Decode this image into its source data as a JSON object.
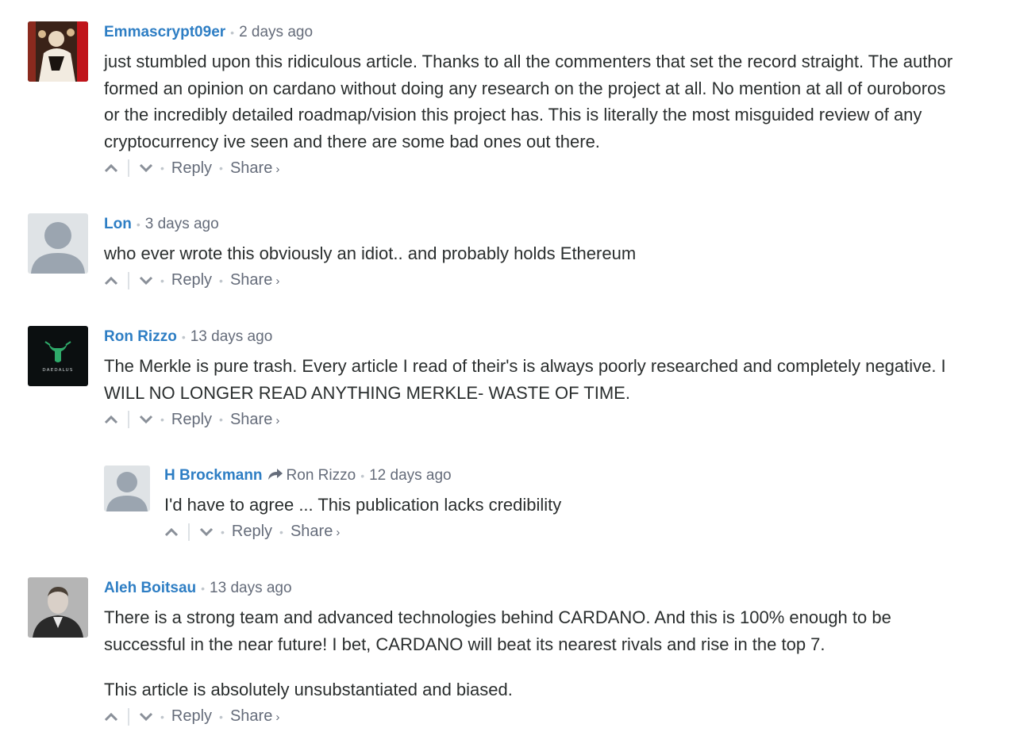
{
  "comments": [
    {
      "author": "Emmascrypt09er",
      "time": "2 days ago",
      "paragraphs": [
        "just stumbled upon this ridiculous article. Thanks to all the commenters that set the record straight. The author formed an opinion on cardano without doing any research on the project at all. No mention at all of ouroboros or the incredibly detailed roadmap/vision this project has. This is literally the most misguided review of any cryptocurrency ive seen and there are some bad ones out there."
      ]
    },
    {
      "author": "Lon",
      "time": "3 days ago",
      "paragraphs": [
        "who ever wrote this obviously an idiot.. and probably holds Ethereum"
      ]
    },
    {
      "author": "Ron Rizzo",
      "time": "13 days ago",
      "avatar_text": "DAEDALUS",
      "paragraphs": [
        "The Merkle is pure trash. Every article I read of their's is always poorly researched and completely negative. I WILL NO LONGER READ ANYTHING MERKLE- WASTE OF TIME."
      ]
    },
    {
      "author": "H Brockmann",
      "in_reply_to": "Ron Rizzo",
      "time": "12 days ago",
      "paragraphs": [
        "I'd have to agree ... This publication lacks credibility"
      ]
    },
    {
      "author": "Aleh Boitsau",
      "time": "13 days ago",
      "paragraphs": [
        "There is a strong team and advanced technologies behind CARDANO. And this is 100% enough to be successful in the near future! I bet, CARDANO will beat its nearest rivals and rise in the top 7.",
        "This article is absolutely unsubstantiated and biased."
      ]
    }
  ],
  "actions": {
    "reply": "Reply",
    "share": "Share",
    "share_chevron": "›",
    "separator": "•"
  },
  "icons": {
    "upvote": "chevron-up-icon",
    "downvote": "chevron-down-icon",
    "reply_arrow": "reply-arrow-icon"
  },
  "colors": {
    "author": "#2e7ec4",
    "meta": "#656c7a",
    "text": "#2a2e2e"
  }
}
